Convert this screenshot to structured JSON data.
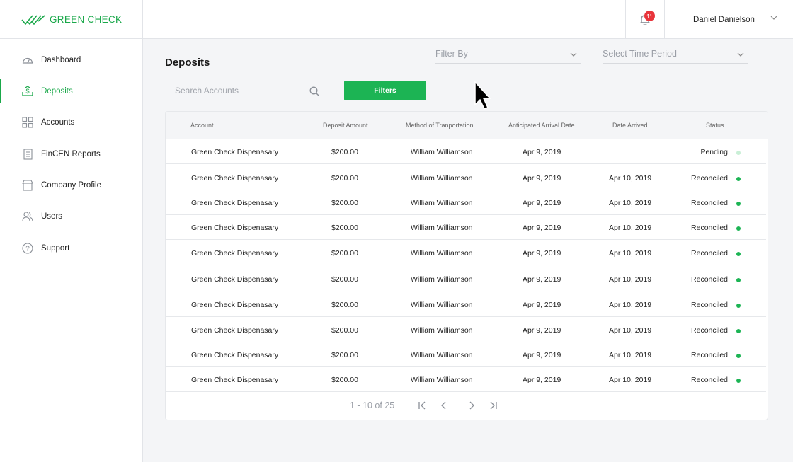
{
  "brand": {
    "name": "GREEN CHECK",
    "accent": "#1aa84a"
  },
  "header": {
    "notification_count": "11",
    "user_name": "Daniel Danielson"
  },
  "sidebar": {
    "items": [
      {
        "label": "Dashboard",
        "icon": "dashboard-icon",
        "active": false
      },
      {
        "label": "Deposits",
        "icon": "deposit-icon",
        "active": true
      },
      {
        "label": "Accounts",
        "icon": "grid-icon",
        "active": false
      },
      {
        "label": "FinCEN Reports",
        "icon": "report-icon",
        "active": false
      },
      {
        "label": "Company Profile",
        "icon": "store-icon",
        "active": false
      },
      {
        "label": "Users",
        "icon": "users-icon",
        "active": false
      },
      {
        "label": "Support",
        "icon": "help-icon",
        "active": false
      }
    ]
  },
  "main": {
    "title": "Deposits",
    "filter_by": "Filter By",
    "time_period": "Select Time Period",
    "search_placeholder": "Search Accounts",
    "filters_button": "Filters"
  },
  "table": {
    "columns": [
      "Account",
      "Deposit Amount",
      "Method of Tranportation",
      "Anticipated Arrival Date",
      "Date Arrived",
      "Status"
    ],
    "rows": [
      {
        "account": "Green Check Dispenasary",
        "amount": "$200.00",
        "method": "William Williamson",
        "anticipated": "Apr 9, 2019",
        "arrived": "",
        "status": "Pending"
      },
      {
        "account": "Green Check Dispenasary",
        "amount": "$200.00",
        "method": "William Williamson",
        "anticipated": "Apr 9, 2019",
        "arrived": "Apr 10, 2019",
        "status": "Reconciled"
      },
      {
        "account": "Green Check Dispenasary",
        "amount": "$200.00",
        "method": "William Williamson",
        "anticipated": "Apr 9, 2019",
        "arrived": "Apr 10, 2019",
        "status": "Reconciled"
      },
      {
        "account": "Green Check Dispenasary",
        "amount": "$200.00",
        "method": "William Williamson",
        "anticipated": "Apr 9, 2019",
        "arrived": "Apr 10, 2019",
        "status": "Reconciled"
      },
      {
        "account": "Green Check Dispenasary",
        "amount": "$200.00",
        "method": "William Williamson",
        "anticipated": "Apr 9, 2019",
        "arrived": "Apr 10, 2019",
        "status": "Reconciled"
      },
      {
        "account": "Green Check Dispenasary",
        "amount": "$200.00",
        "method": "William Williamson",
        "anticipated": "Apr 9, 2019",
        "arrived": "Apr 10, 2019",
        "status": "Reconciled"
      },
      {
        "account": "Green Check Dispenasary",
        "amount": "$200.00",
        "method": "William Williamson",
        "anticipated": "Apr 9, 2019",
        "arrived": "Apr 10, 2019",
        "status": "Reconciled"
      },
      {
        "account": "Green Check Dispenasary",
        "amount": "$200.00",
        "method": "William Williamson",
        "anticipated": "Apr 9, 2019",
        "arrived": "Apr 10, 2019",
        "status": "Reconciled"
      },
      {
        "account": "Green Check Dispenasary",
        "amount": "$200.00",
        "method": "William Williamson",
        "anticipated": "Apr 9, 2019",
        "arrived": "Apr 10, 2019",
        "status": "Reconciled"
      },
      {
        "account": "Green Check Dispenasary",
        "amount": "$200.00",
        "method": "William Williamson",
        "anticipated": "Apr 9, 2019",
        "arrived": "Apr 10, 2019",
        "status": "Reconciled"
      }
    ],
    "status_colors": {
      "Pending": "#c9efd6",
      "Reconciled": "#1cb454"
    }
  },
  "pagination": {
    "range": "1 - 10 of 25"
  }
}
